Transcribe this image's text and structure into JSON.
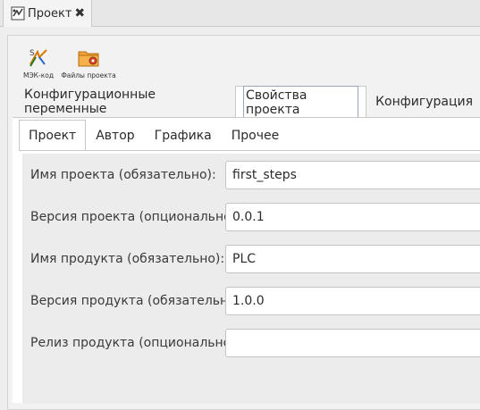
{
  "doc_tab": {
    "title": "Проект",
    "close_glyph": "✖",
    "icon": "project-icon"
  },
  "toolbar": {
    "buttons": [
      {
        "label": "МЭК-код",
        "icon": "iec-code-icon"
      },
      {
        "label": "Файлы проекта",
        "icon": "project-files-icon"
      }
    ]
  },
  "project_tabs": [
    {
      "label": "Конфигурационные переменные",
      "active": false
    },
    {
      "label": "Свойства проекта",
      "active": true
    },
    {
      "label": "Конфигурация",
      "active": false
    }
  ],
  "inner_tabs": [
    {
      "label": "Проект",
      "active": true
    },
    {
      "label": "Автор",
      "active": false
    },
    {
      "label": "Графика",
      "active": false
    },
    {
      "label": "Прочее",
      "active": false
    }
  ],
  "fields": [
    {
      "label": "Имя проекта (обязательно):",
      "value": "first_steps"
    },
    {
      "label": "Версия проекта (опционально):",
      "value": "0.0.1"
    },
    {
      "label": "Имя продукта (обязательно):",
      "value": "PLC"
    },
    {
      "label": "Версия продукта (обязательно):",
      "value": "1.0.0"
    },
    {
      "label": "Релиз продукта (опционально):",
      "value": ""
    }
  ],
  "colors": {
    "background": "#eeeeee",
    "field_border": "#c4c4c4",
    "form_bg": "#ececec"
  }
}
